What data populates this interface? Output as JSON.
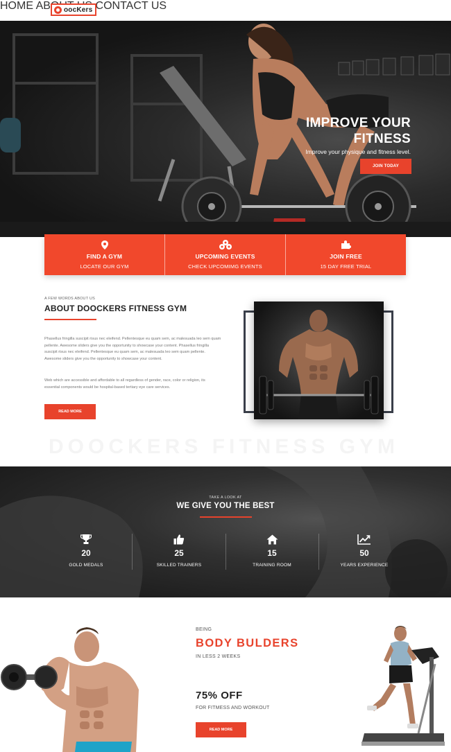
{
  "brand": {
    "logo_text": "oocKers",
    "accent": "#e8432c"
  },
  "nav": {
    "items": [
      "HOME",
      "ABOUT US",
      "CONTACT US"
    ]
  },
  "hero": {
    "title_line1": "IMPROVE YOUR",
    "title_line2": "FITNESS",
    "subtitle": "Improve your physique and fitness level.",
    "button": "JOIN TODAY"
  },
  "features": [
    {
      "icon": "location-pin-icon",
      "title": "FIND A GYM",
      "subtitle": "LOCATE OUR GYM"
    },
    {
      "icon": "events-icon",
      "title": "UPCOMING EVENTS",
      "subtitle": "CHECK UPCOMIMG EVENTS"
    },
    {
      "icon": "puzzle-icon",
      "title": "JOIN FREE",
      "subtitle": "15 DAY FREE TRIAL"
    }
  ],
  "about": {
    "kicker": "A FEW WORDS ABOUT US",
    "title": "ABOUT DOOCKERS FITNESS GYM",
    "paragraph1": "Phasellus fringilla suscipit risus nec eleifend. Pellentesque eu quam sem, ac malesuada leo sem quam pellente. Awesome sliders give you the opportunity to showcase your content. Phasellus fringilla suscipit risus nec eleifend. Pellentesque eu quam sem, ac malesuada leo sem quam pellente. Awesome sliders give you the opportunity to showcase your content.",
    "paragraph2": "Web which are accessible and affordable to all regardless of gender, race, color or religion, its essential components would be hospital-based tertiary eye care services.",
    "button": "READ MORE"
  },
  "watermark": "DOOCKERS FITNESS GYM",
  "stats": {
    "kicker": "TAKE A LOOK AT",
    "title": "WE GIVE YOU THE BEST",
    "items": [
      {
        "icon": "trophy-icon",
        "number": "20",
        "label": "GOLD MEDALS"
      },
      {
        "icon": "thumbs-up-icon",
        "number": "25",
        "label": "SKILLED TRAINERS"
      },
      {
        "icon": "home-icon",
        "number": "15",
        "label": "TRAINING ROOM"
      },
      {
        "icon": "line-chart-icon",
        "number": "50",
        "label": "YEARS EXPERIENCE"
      }
    ]
  },
  "body_builders": {
    "kicker": "BEING",
    "title": "BODY BULDERS",
    "subtitle": "IN LESS 2 WEEKS",
    "offer": "75% OFF",
    "offer_sub": "FOR FITMESS AND WORKOUT",
    "button": "READ MORE"
  }
}
